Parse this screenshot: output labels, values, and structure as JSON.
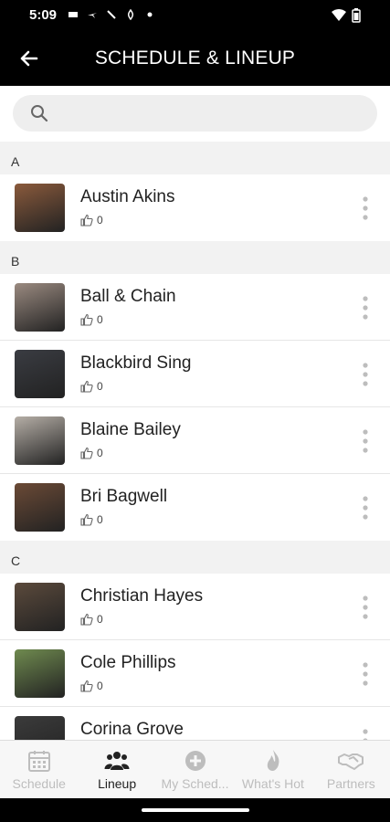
{
  "status": {
    "time": "5:09",
    "icons_left": [
      "cast-icon",
      "plane-icon",
      "needle-icon",
      "fire-icon",
      "dot-icon"
    ],
    "icons_right": [
      "wifi-icon",
      "battery-icon"
    ]
  },
  "app_bar": {
    "title": "SCHEDULE & LINEUP"
  },
  "search": {
    "placeholder": "",
    "value": ""
  },
  "sections": [
    {
      "letter": "A",
      "artists": [
        {
          "name": "Austin Akins",
          "likes": "0",
          "photo_color": "#8a5a3c"
        }
      ]
    },
    {
      "letter": "B",
      "artists": [
        {
          "name": "Ball & Chain",
          "likes": "0",
          "photo_color": "#9a8a80"
        },
        {
          "name": "Blackbird Sing",
          "likes": "0",
          "photo_color": "#3a3c42"
        },
        {
          "name": "Blaine Bailey",
          "likes": "0",
          "photo_color": "#b5aea6"
        },
        {
          "name": "Bri Bagwell",
          "likes": "0",
          "photo_color": "#6b4a36"
        }
      ]
    },
    {
      "letter": "C",
      "artists": [
        {
          "name": "Christian Hayes",
          "likes": "0",
          "photo_color": "#5b4a3c"
        },
        {
          "name": "Cole Phillips",
          "likes": "0",
          "photo_color": "#6f8a4f"
        },
        {
          "name": "Corina Grove",
          "likes": "",
          "photo_color": "#3b3b3b"
        }
      ]
    }
  ],
  "bottom_nav": [
    {
      "label": "Schedule",
      "icon": "calendar-icon",
      "active": false
    },
    {
      "label": "Lineup",
      "icon": "people-icon",
      "active": true
    },
    {
      "label": "My Sched...",
      "icon": "plus-circle-icon",
      "active": false
    },
    {
      "label": "What's Hot",
      "icon": "flame-icon",
      "active": false
    },
    {
      "label": "Partners",
      "icon": "handshake-icon",
      "active": false
    }
  ],
  "colors": {
    "app_bar": "#000000",
    "section_bg": "#f2f2f2",
    "nav_inactive": "#bdbdbd",
    "nav_active": "#222222"
  }
}
